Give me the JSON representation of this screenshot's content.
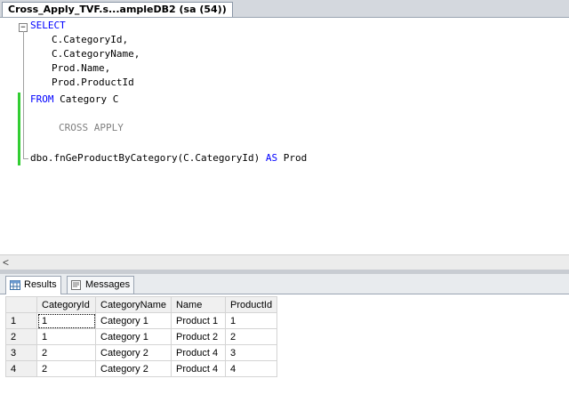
{
  "document_tab": {
    "title": "Cross_Apply_TVF.s...ampleDB2 (sa (54))"
  },
  "editor": {
    "lines": [
      {
        "kw": "SELECT",
        "rest": ""
      },
      {
        "kw": "",
        "rest": "C.CategoryId,"
      },
      {
        "kw": "",
        "rest": "C.CategoryName,"
      },
      {
        "kw": "",
        "rest": "Prod.Name,"
      },
      {
        "kw": "",
        "rest": "Prod.ProductId"
      },
      {
        "kw": "FROM",
        "rest": " Category C"
      },
      {
        "kw": "",
        "rest": "CROSS APPLY"
      },
      {
        "kw": "",
        "rest": "dbo.fnGeProductByCategory(C.CategoryId) ",
        "kw2": "AS",
        "rest2": " Prod"
      }
    ],
    "fold_symbol": "−"
  },
  "scrollbar": {
    "left_arrow": "<"
  },
  "result_tabs": [
    {
      "label": "Results"
    },
    {
      "label": "Messages"
    }
  ],
  "grid": {
    "columns": [
      "",
      "CategoryId",
      "CategoryName",
      "Name",
      "ProductId"
    ],
    "rows": [
      [
        "1",
        "1",
        "Category 1",
        "Product 1",
        "1"
      ],
      [
        "2",
        "1",
        "Category 1",
        "Product 2",
        "2"
      ],
      [
        "3",
        "2",
        "Category 2",
        "Product 4",
        "3"
      ],
      [
        "4",
        "2",
        "Category 2",
        "Product 4",
        "4"
      ]
    ]
  },
  "colors": {
    "keyword": "#0000ff",
    "change_bar": "#32cd32"
  }
}
